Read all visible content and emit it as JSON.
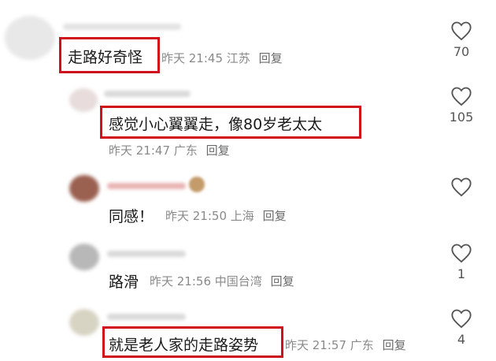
{
  "comments": [
    {
      "text": "走路好奇怪",
      "time": "昨天 21:45",
      "location": "江苏",
      "reply": "回复",
      "likes": "70"
    },
    {
      "text": "感觉小心翼翼走，像80岁老太太",
      "time": "昨天 21:47",
      "location": "广东",
      "reply": "回复",
      "likes": "105"
    },
    {
      "text": "同感！",
      "time": "昨天 21:50",
      "location": "上海",
      "reply": "回复",
      "likes": ""
    },
    {
      "text": "路滑",
      "time": "昨天 21:56",
      "location": "中国台湾",
      "reply": "回复",
      "likes": "1"
    },
    {
      "text": "就是老人家的走路姿势",
      "time": "昨天 21:57",
      "location": "广东",
      "reply": "回复",
      "likes": "4"
    }
  ],
  "colors": {
    "highlight": "#d0101b",
    "meta": "#8a8a8a"
  },
  "icons": {
    "like": "heart-outline-icon"
  }
}
